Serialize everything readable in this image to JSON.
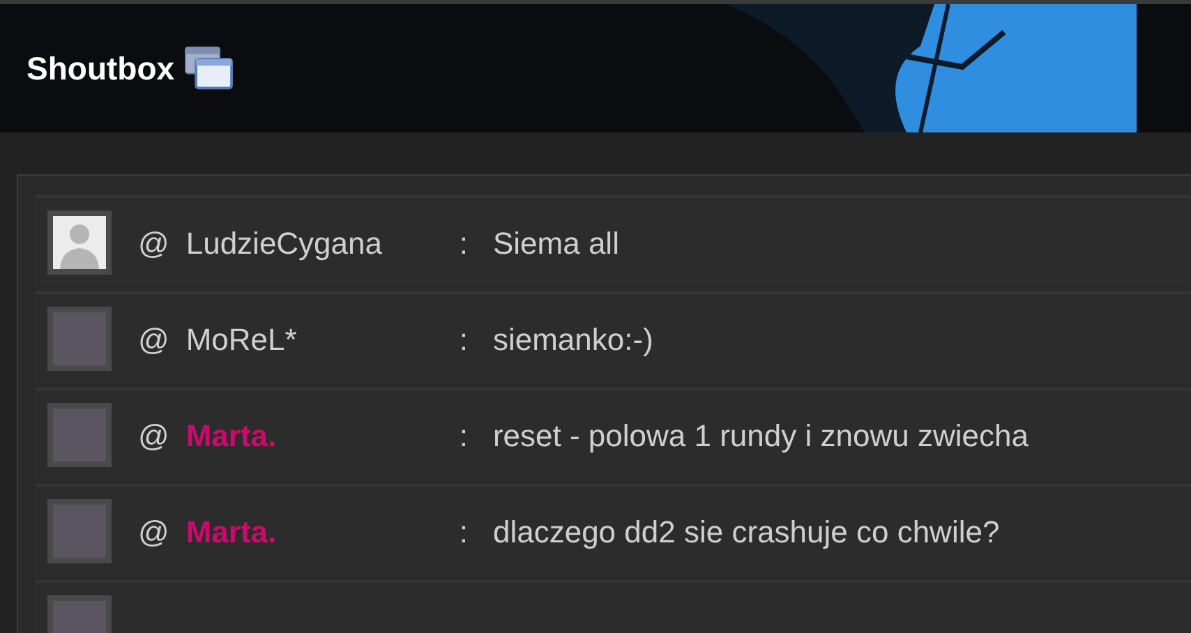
{
  "header": {
    "title": "Shoutbox"
  },
  "messages": [
    {
      "kind": "full",
      "avatar": {
        "kind": "silhouette"
      },
      "at": "@",
      "user": "LudzieCygana",
      "color": "#cfcfcf",
      "separator": ":",
      "text": "Siema all"
    },
    {
      "kind": "full",
      "avatar": {
        "kind": "photo"
      },
      "at": "@",
      "user": "MoReL*",
      "color": "#cfcfcf",
      "separator": ":",
      "text": "siemanko:-)"
    },
    {
      "kind": "full",
      "avatar": {
        "kind": "photo"
      },
      "at": "@",
      "user": "Marta.",
      "color": "#cc0a6e",
      "separator": ":",
      "text": "reset - polowa 1 rundy i znowu zwiecha"
    },
    {
      "kind": "full",
      "avatar": {
        "kind": "photo"
      },
      "at": "@",
      "user": "Marta.",
      "color": "#cc0a6e",
      "separator": ":",
      "text": "dlaczego dd2 sie crashuje co chwile?"
    },
    {
      "kind": "cut",
      "avatar": {
        "kind": "photo"
      }
    }
  ]
}
